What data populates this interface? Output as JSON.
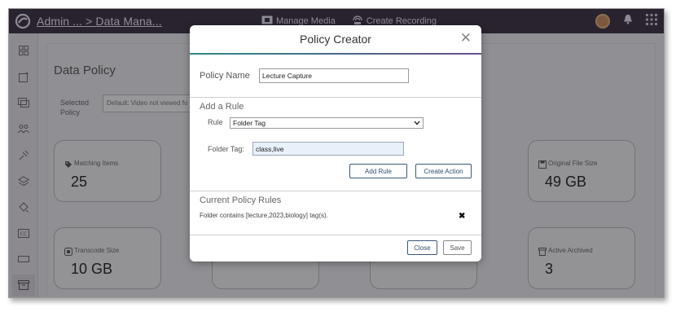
{
  "header": {
    "breadcrumb": "Admin ... > Data Mana...",
    "actions": [
      {
        "label": "Manage Media",
        "icon": "film-icon"
      },
      {
        "label": "Create Recording",
        "icon": "broadcast-icon"
      }
    ],
    "right_icons": [
      "avatar",
      "bell-icon",
      "apps-grid-icon"
    ]
  },
  "sidebar": {
    "items": [
      {
        "icon": "dashboard-icon"
      },
      {
        "icon": "content-icon"
      },
      {
        "icon": "media-icon"
      },
      {
        "icon": "users-icon"
      },
      {
        "icon": "integrations-icon"
      },
      {
        "icon": "layers-icon"
      },
      {
        "icon": "policy-icon"
      },
      {
        "icon": "captions-icon"
      },
      {
        "icon": "display-icon"
      },
      {
        "icon": "archive-icon",
        "active": true
      }
    ]
  },
  "page": {
    "title": "Data Policy",
    "selected_policy_label": "Selected Policy",
    "selected_policy_value": "Default: Video not viewed fo",
    "cards": [
      {
        "title": "Matching Items",
        "value": "25",
        "icon": "tag-icon"
      },
      {
        "title": "Original File Size",
        "value": "49 GB",
        "icon": "save-icon"
      },
      {
        "title": "Transcode Size",
        "value": "10 GB",
        "icon": "transcode-icon"
      },
      {
        "title": "Active Archived",
        "value": "3",
        "icon": "archive-box-icon"
      }
    ]
  },
  "modal": {
    "title": "Policy Creator",
    "policy_name_label": "Policy Name",
    "policy_name_value": "Lecture Capture",
    "add_rule_section": "Add a Rule",
    "rule_label": "Rule",
    "rule_value": "Folder Tag",
    "folder_tag_label": "Folder Tag:",
    "folder_tag_value": "class,live",
    "add_rule_button": "Add Rule",
    "create_action_button": "Create Action",
    "current_rules_section": "Current Policy Rules",
    "rules": [
      {
        "text": "Folder contains [lecture,2023,biology] tag(s)."
      }
    ],
    "close_button": "Close",
    "save_button": "Save"
  },
  "colors": {
    "topbar": "#3a3040",
    "accent": "#2f4f70",
    "title_gradient_start": "#2b8a86",
    "title_gradient_end": "#6b4f8f"
  }
}
